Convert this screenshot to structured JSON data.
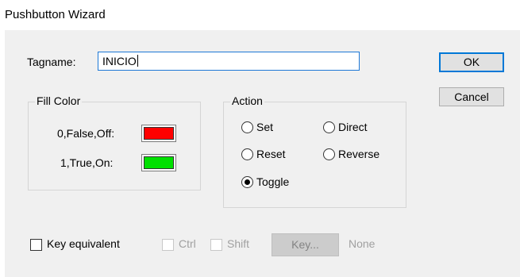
{
  "window": {
    "title": "Pushbutton Wizard"
  },
  "tagname": {
    "label": "Tagname:",
    "value": "INICIO"
  },
  "buttons": {
    "ok": "OK",
    "cancel": "Cancel"
  },
  "fill_color": {
    "title": "Fill Color",
    "off_label": "0,False,Off:",
    "off_color": "#ff0000",
    "on_label": "1,True,On:",
    "on_color": "#00e000"
  },
  "action": {
    "title": "Action",
    "options": {
      "set": "Set",
      "direct": "Direct",
      "reset": "Reset",
      "reverse": "Reverse",
      "toggle": "Toggle"
    },
    "selected": "Toggle"
  },
  "key_equivalent": {
    "label": "Key equivalent",
    "checked": false,
    "ctrl": "Ctrl",
    "shift": "Shift",
    "key_button": "Key...",
    "key_value": "None"
  }
}
